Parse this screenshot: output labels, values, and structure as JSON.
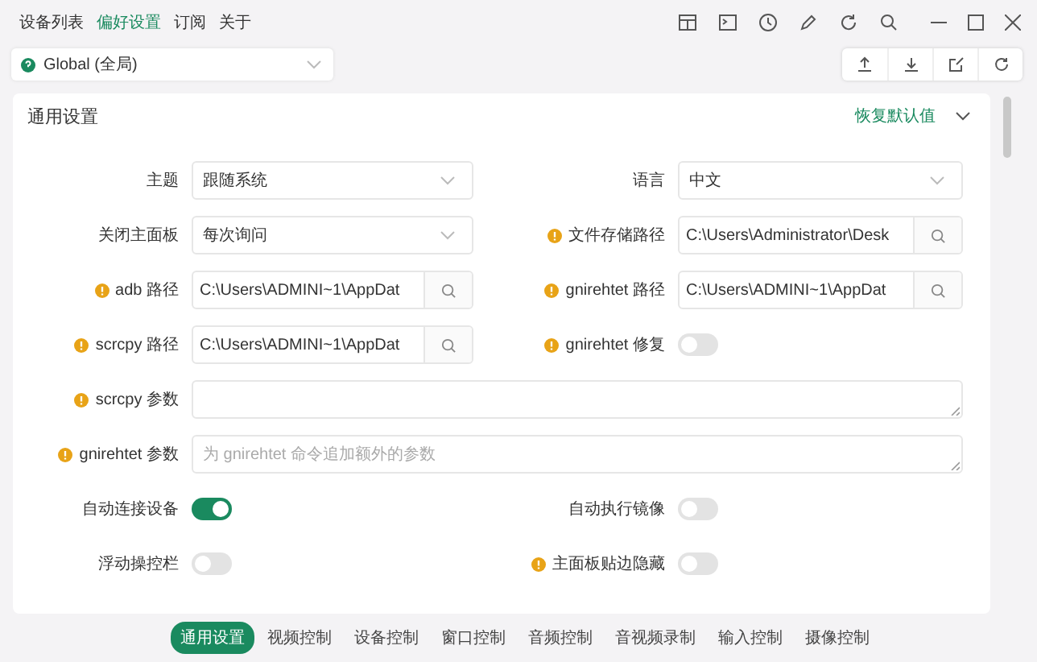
{
  "menu": [
    {
      "label": "设备列表",
      "selected": false
    },
    {
      "label": "偏好设置",
      "selected": true
    },
    {
      "label": "订阅",
      "selected": false
    },
    {
      "label": "关于",
      "selected": false
    }
  ],
  "scope_select": {
    "value": "Global (全局)"
  },
  "card": {
    "title": "通用设置",
    "reset_link": "恢复默认值",
    "expanded": true
  },
  "settings": [
    {
      "kind": "select",
      "label": "主题",
      "info": false,
      "value": "跟随系统"
    },
    {
      "kind": "select",
      "label": "语言",
      "info": false,
      "value": "中文"
    },
    {
      "kind": "select",
      "label": "关闭主面板",
      "info": false,
      "value": "每次询问"
    },
    {
      "kind": "path",
      "label": "文件存储路径",
      "info": true,
      "value": "C:\\Users\\Administrator\\Desk"
    },
    {
      "kind": "path",
      "label": "adb 路径",
      "info": true,
      "value": "C:\\Users\\ADMINI~1\\AppDat"
    },
    {
      "kind": "path",
      "label": "gnirehtet 路径",
      "info": true,
      "value": "C:\\Users\\ADMINI~1\\AppDat"
    },
    {
      "kind": "path",
      "label": "scrcpy 路径",
      "info": true,
      "value": "C:\\Users\\ADMINI~1\\AppDat"
    },
    {
      "kind": "switch",
      "label": "gnirehtet 修复",
      "info": true,
      "on": false
    },
    {
      "kind": "textarea",
      "label": "scrcpy 参数",
      "info": true
    },
    {
      "kind": "textarea",
      "label": "gnirehtet 参数",
      "info": true,
      "placeholder": "为 gnirehtet 命令追加额外的参数"
    },
    {
      "kind": "switch",
      "label": "自动连接设备",
      "info": false,
      "on": true
    },
    {
      "kind": "switch",
      "label": "自动执行镜像",
      "info": false,
      "on": false
    },
    {
      "kind": "switch",
      "label": "浮动操控栏",
      "info": false,
      "on": false
    },
    {
      "kind": "switch",
      "label": "主面板贴边隐藏",
      "info": true,
      "on": false
    }
  ],
  "section_tabs": [
    {
      "label": "通用设置",
      "selected": true
    },
    {
      "label": "视频控制",
      "selected": false
    },
    {
      "label": "设备控制",
      "selected": false
    },
    {
      "label": "窗口控制",
      "selected": false
    },
    {
      "label": "音频控制",
      "selected": false
    },
    {
      "label": "音视频录制",
      "selected": false
    },
    {
      "label": "输入控制",
      "selected": false
    },
    {
      "label": "摄像控制",
      "selected": false
    }
  ]
}
